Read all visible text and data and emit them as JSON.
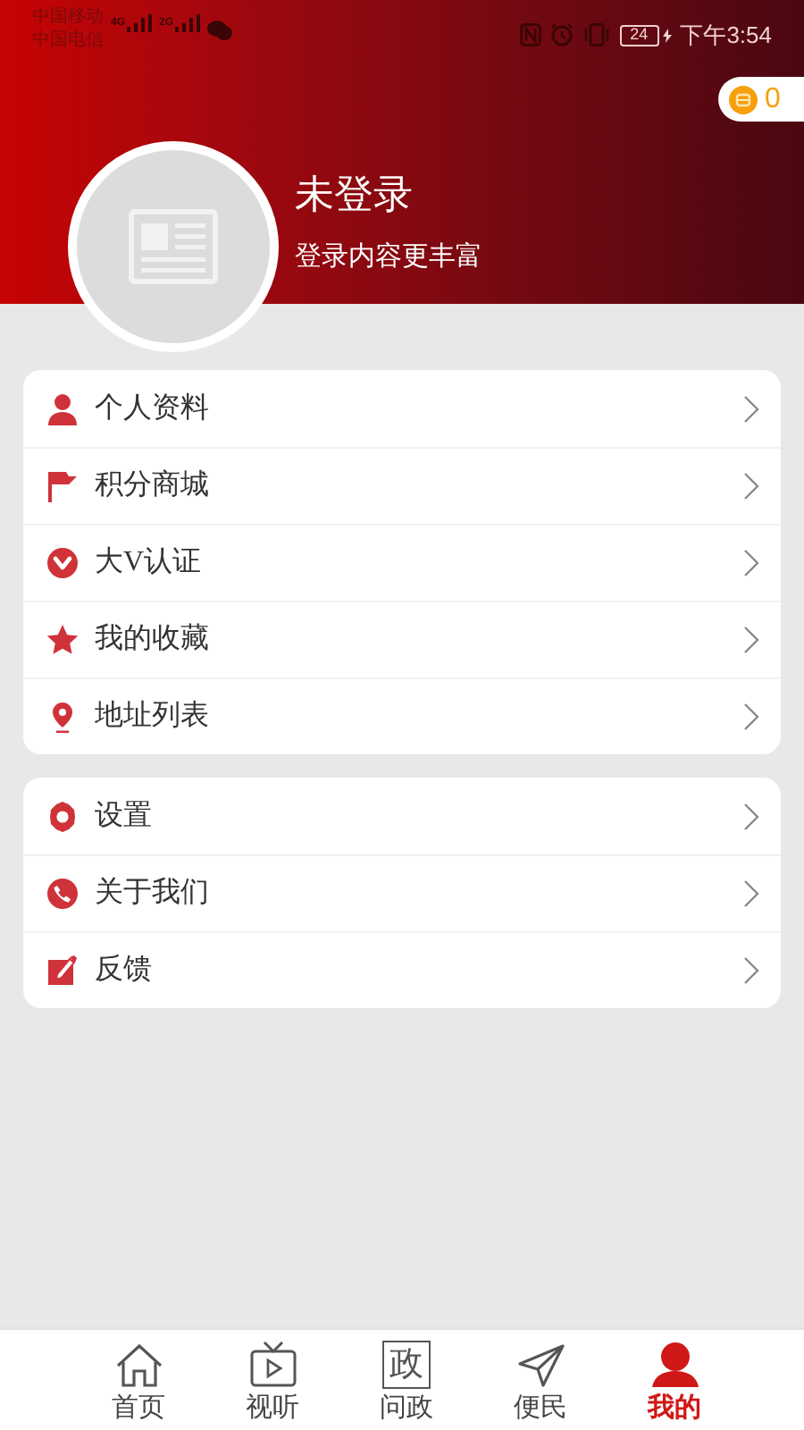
{
  "status_bar": {
    "carriers": [
      "中国移动",
      "中国电信"
    ],
    "networks": [
      "4G",
      "2G"
    ],
    "battery": "24",
    "time": "下午3:54"
  },
  "points_badge": {
    "count": "0"
  },
  "profile": {
    "name": "未登录",
    "subtitle": "登录内容更丰富"
  },
  "menu_groups": [
    {
      "items": [
        {
          "kind": "person",
          "label": "个人资料"
        },
        {
          "kind": "flag",
          "label": "积分商城"
        },
        {
          "kind": "vbadge",
          "label": "大V认证"
        },
        {
          "kind": "star",
          "label": "我的收藏"
        },
        {
          "kind": "pin",
          "label": "地址列表"
        }
      ]
    },
    {
      "items": [
        {
          "kind": "gear",
          "label": "设置"
        },
        {
          "kind": "phone",
          "label": "关于我们"
        },
        {
          "kind": "edit",
          "label": "反馈"
        }
      ]
    }
  ],
  "bottom_nav": [
    {
      "kind": "home",
      "label": "首页",
      "selected": false
    },
    {
      "kind": "tv",
      "label": "视听",
      "selected": false
    },
    {
      "kind": "glyph",
      "icon_text": "政",
      "label": "问政",
      "selected": false
    },
    {
      "kind": "send",
      "label": "便民",
      "selected": false
    },
    {
      "kind": "user",
      "label": "我的",
      "selected": true
    }
  ]
}
